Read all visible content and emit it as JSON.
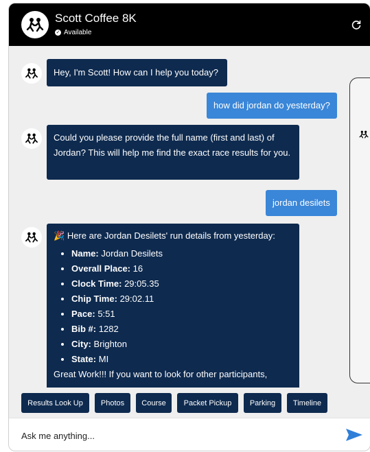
{
  "header": {
    "title": "Scott Coffee 8K",
    "status": "Available"
  },
  "messages": {
    "m1": "Hey, I'm Scott! How can I help you today?",
    "m2": "how did jordan do yesterday?",
    "m3": "Could you please provide the full name (first and last) of Jordan? This will help me find the exact race results for you.",
    "m4": "jordan desilets",
    "m5_intro": "Here are Jordan Desilets' run details from yesterday:",
    "details": [
      {
        "label": "Name:",
        "value": "Jordan Desilets"
      },
      {
        "label": "Overall Place:",
        "value": "16"
      },
      {
        "label": "Clock Time:",
        "value": "29:05.35"
      },
      {
        "label": "Chip Time:",
        "value": "29:02.11"
      },
      {
        "label": "Pace:",
        "value": "5:51"
      },
      {
        "label": "Bib #:",
        "value": "1282"
      },
      {
        "label": "City:",
        "value": "Brighton"
      },
      {
        "label": "State:",
        "value": "MI"
      }
    ],
    "m5_outro": "Great Work!!! If you want to look for other participants,"
  },
  "quick_actions": [
    "Results Look Up",
    "Photos",
    "Course",
    "Packet Pickup",
    "Parking",
    "Timeline"
  ],
  "input": {
    "placeholder": "Ask me anything..."
  },
  "colors": {
    "header": "#000000",
    "bot_bubble": "#0e2a4f",
    "user_bubble": "#3a86d8",
    "send": "#2f7fd8"
  }
}
